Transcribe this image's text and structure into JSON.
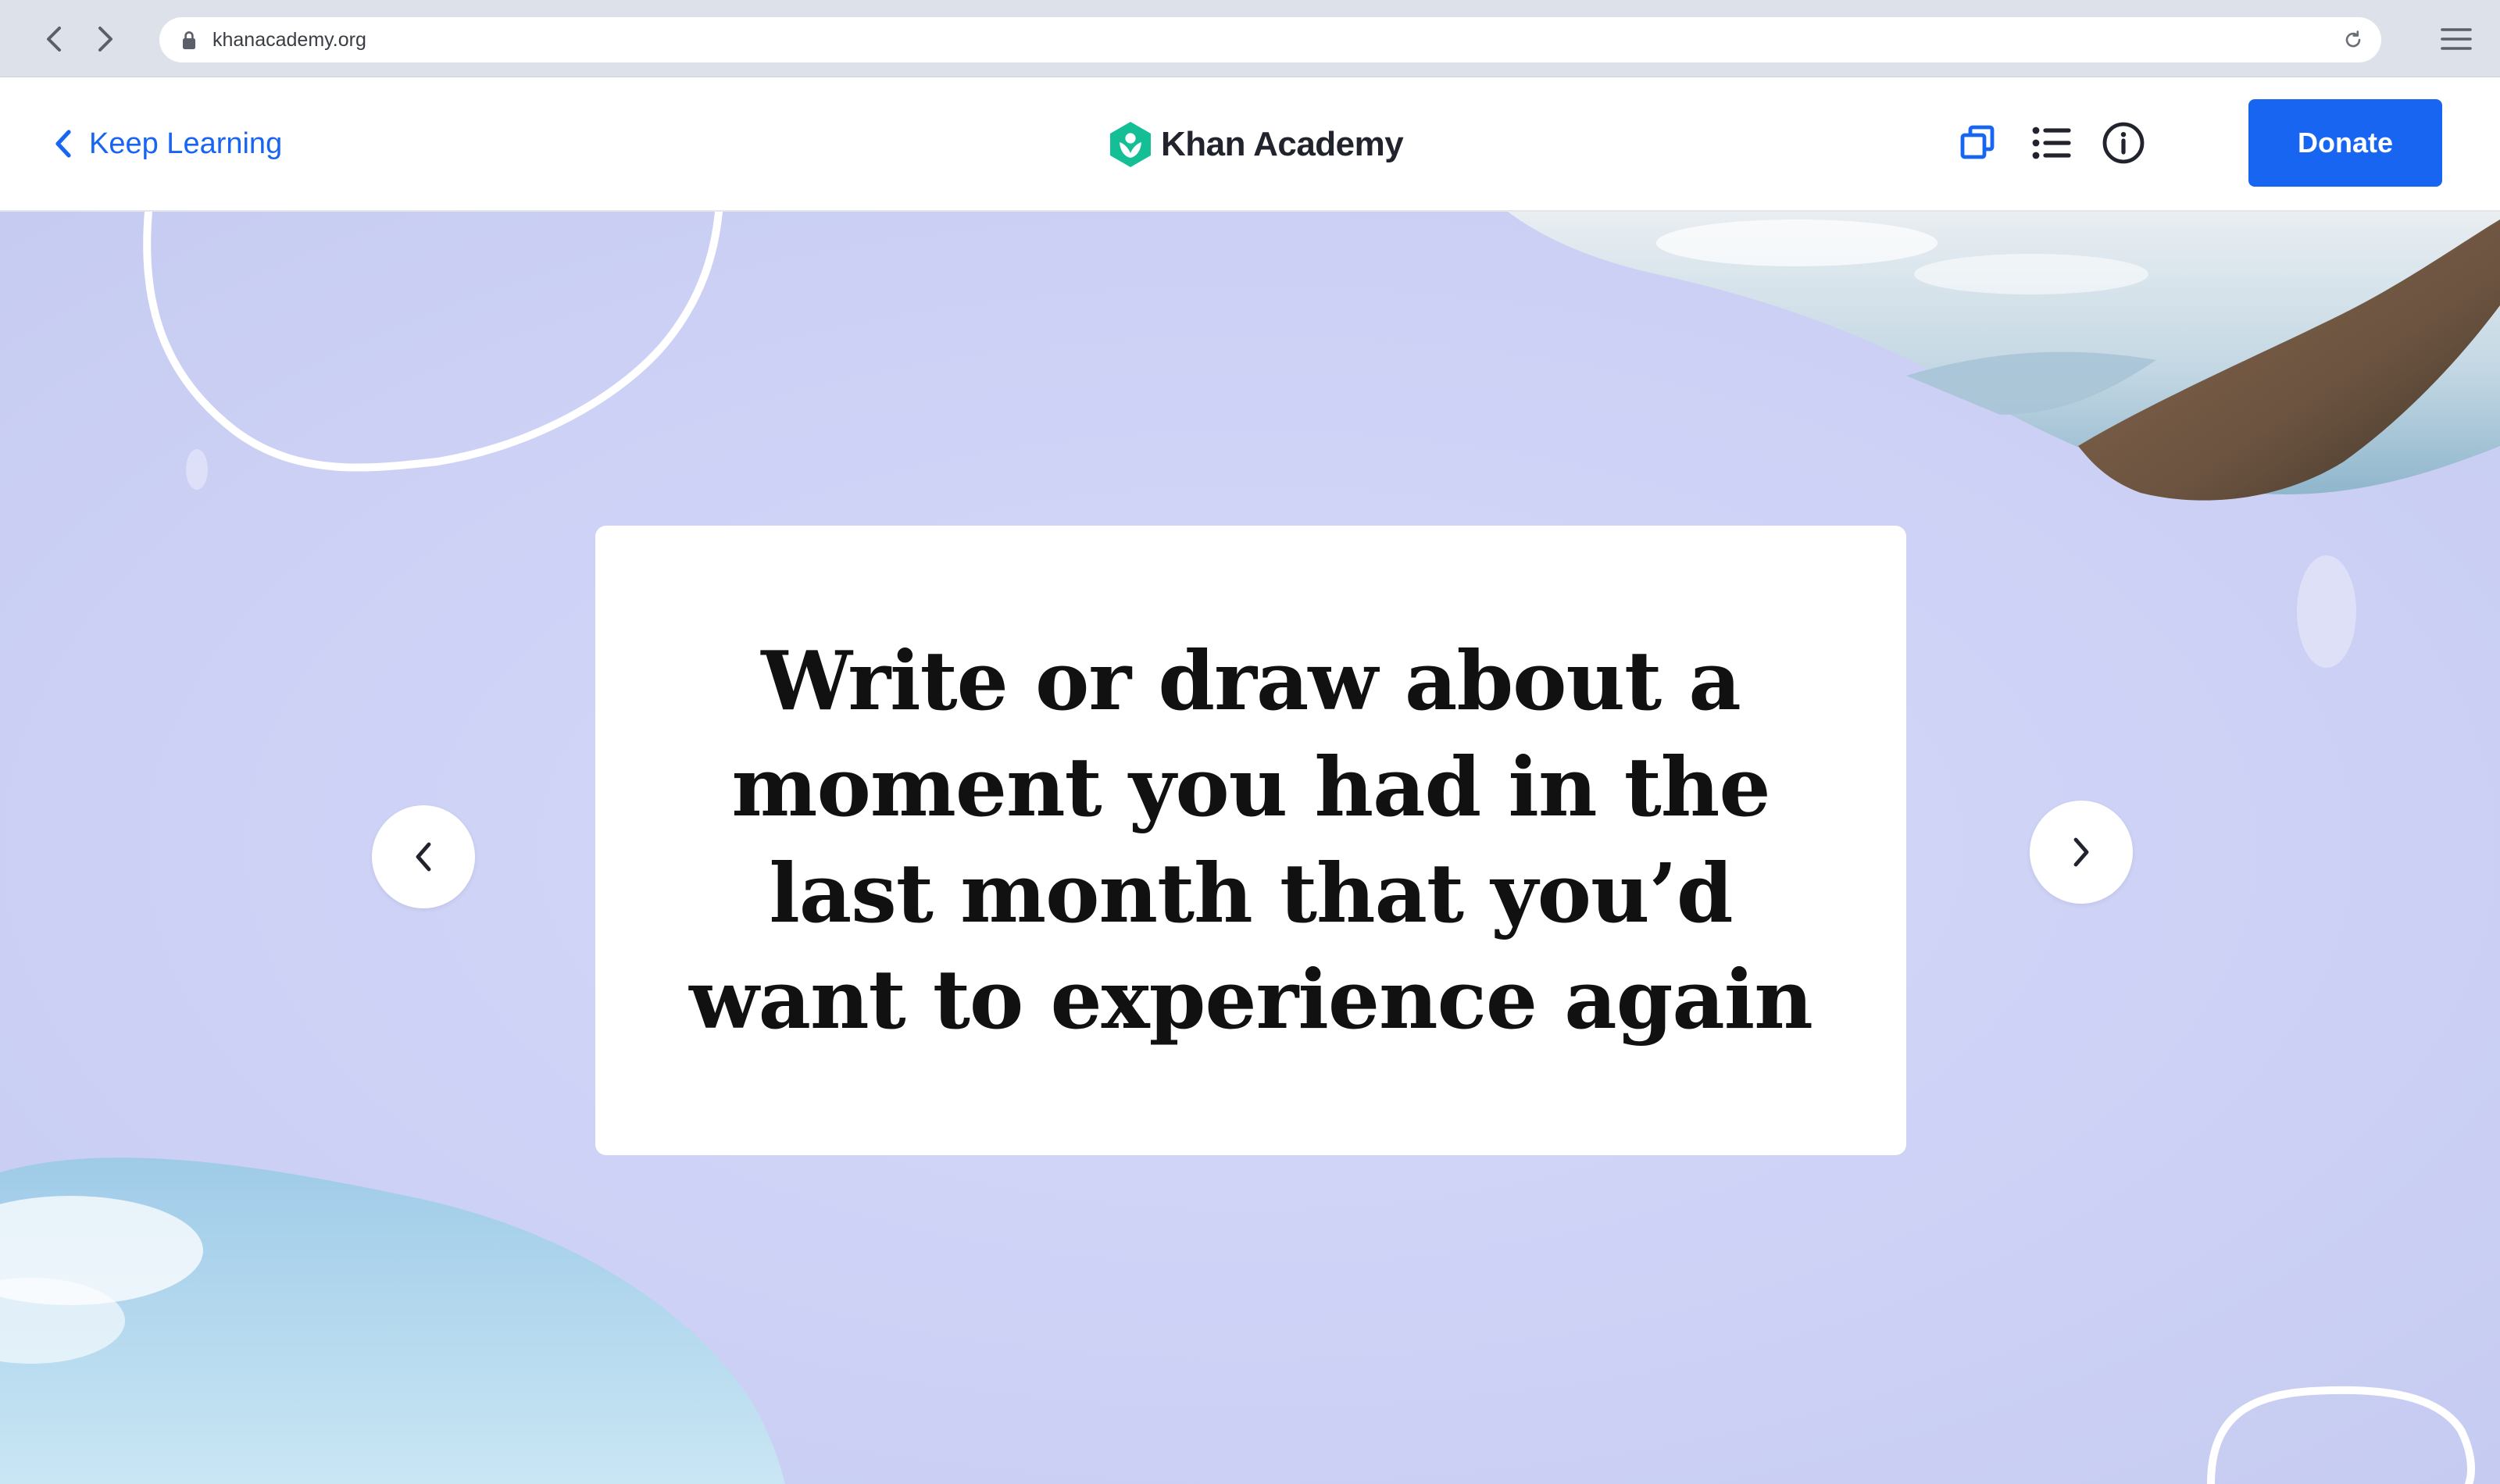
{
  "browser": {
    "url": "khanacademy.org",
    "icons": [
      "back-arrow-icon",
      "forward-arrow-icon",
      "lock-icon",
      "reload-icon",
      "menu-icon"
    ]
  },
  "header": {
    "back_link": "Keep Learning",
    "brand": "Khan Academy",
    "icons": [
      "copy-cards-icon",
      "list-icon",
      "info-icon"
    ],
    "donate_label": "Donate"
  },
  "prompt": {
    "text": "Write or draw about a moment you had in the last month that you’d want to experience again"
  },
  "carousel": {
    "icons": [
      "chevron-left-icon",
      "chevron-right-icon"
    ]
  },
  "colors": {
    "accent": "#1865f2",
    "brand_green": "#14bf96",
    "background": "#cdd1f5",
    "card": "#ffffff"
  }
}
